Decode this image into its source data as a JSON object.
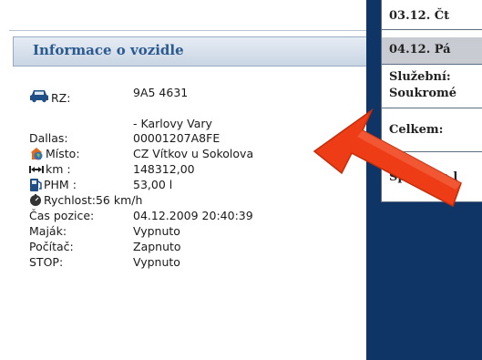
{
  "panel": {
    "title": "Informace o vozidle"
  },
  "vehicle": {
    "rz_label": "RZ:",
    "rz_value": "9A5 4631",
    "rz_region": "- Karlovy Vary",
    "dallas_label": "Dallas:",
    "dallas_value": "00001207A8FE",
    "misto_label": "Místo:",
    "misto_value": "CZ Vítkov u Sokolova",
    "km_label": "km :",
    "km_value": "148312,00",
    "phm_label": "PHM :",
    "phm_value": "53,00 l",
    "rychlost_label": "Rychlost:",
    "rychlost_value": "56 km/h",
    "cas_label": "Čas pozice:",
    "cas_value": "04.12.2009 20:40:39",
    "majak_label": "Maják:",
    "majak_value": "Vypnuto",
    "pocitac_label": "Počítač:",
    "pocitac_value": "Zapnuto",
    "stop_label": "STOP:",
    "stop_value": "Vypnuto"
  },
  "table": {
    "row1": "03.12. Čt",
    "row2": "04.12. Pá",
    "row3a": "Služební:",
    "row3b": "Soukromé",
    "row4": "Celkem:",
    "row5": "Spotřeba l"
  },
  "icons": [
    "car-icon",
    "location-icon",
    "distance-icon",
    "fuel-pump-icon",
    "speed-icon",
    "arrow-icon"
  ],
  "colors": {
    "title": "#2b5a8f",
    "dark_panel": "#0f3466",
    "arrow": "#ee3d16"
  }
}
